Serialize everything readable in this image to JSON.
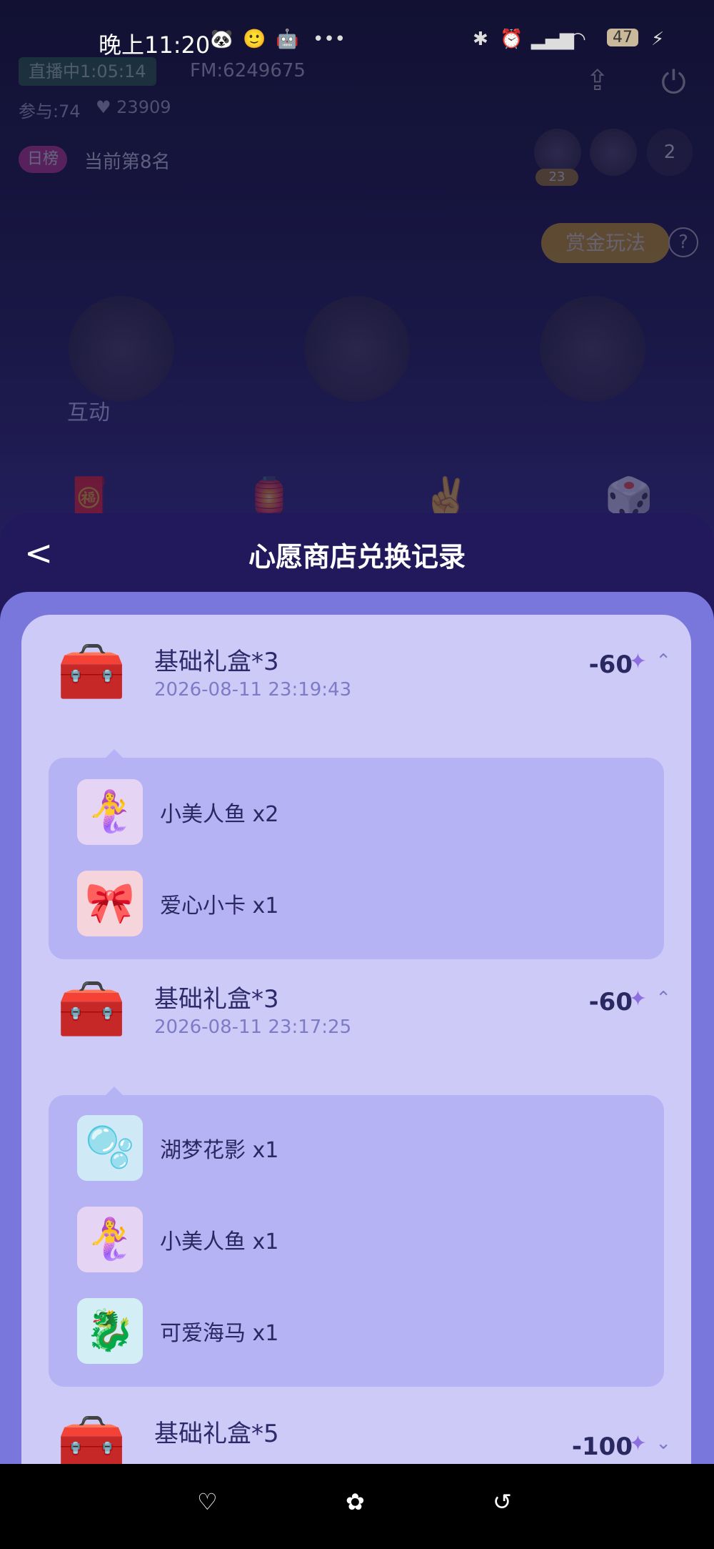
{
  "status_bar": {
    "time": "晚上11:20",
    "notification_icons": [
      "🐼",
      "🙂",
      "🤖"
    ],
    "more": "•••",
    "right_icons": [
      "bluetooth-icon",
      "alarm-icon",
      "signal-icon",
      "wifi-icon"
    ],
    "battery": "47"
  },
  "stream": {
    "live_label": "直播中1:05:14",
    "fm": "FM:6249675",
    "participants": "参与:74",
    "likes": "23909",
    "rank_tag": "日榜",
    "rank_text": "当前第8名",
    "viewer_badge": "23",
    "viewer_count": "2",
    "bounty_button": "赏金玩法",
    "help": "?",
    "interact_title": "互动"
  },
  "sheet": {
    "title": "心愿商店兑换记录",
    "back": "<"
  },
  "records": [
    {
      "title": "基础礼盒*3",
      "date": "2026-08-11 23:19:43",
      "amount": "-60",
      "expanded": true,
      "items": [
        {
          "name": "小美人鱼 x2",
          "icon": "🧜‍♀️"
        },
        {
          "name": "爱心小卡 x1",
          "icon": "🎀"
        }
      ]
    },
    {
      "title": "基础礼盒*3",
      "date": "2026-08-11 23:17:25",
      "amount": "-60",
      "expanded": true,
      "items": [
        {
          "name": "湖梦花影 x1",
          "icon": "🫧"
        },
        {
          "name": "小美人鱼 x1",
          "icon": "🧜‍♀️"
        },
        {
          "name": "可爱海马 x1",
          "icon": "🐉"
        }
      ]
    },
    {
      "title": "基础礼盒*5",
      "date": "",
      "amount": "-100",
      "expanded": false,
      "items": []
    }
  ],
  "colors": {
    "accent_panel": "#7a77dc",
    "card": "#cdcaf8",
    "detail": "#b6b3f4",
    "sheet": "#22185c"
  }
}
